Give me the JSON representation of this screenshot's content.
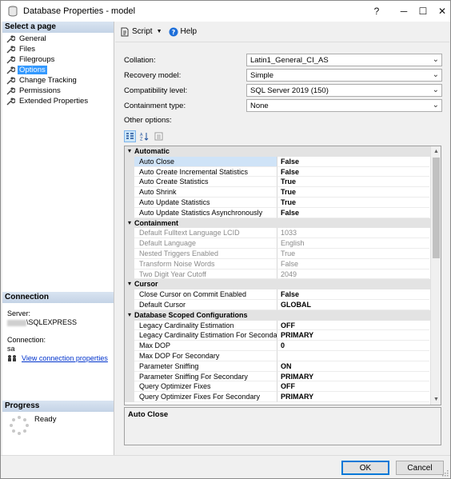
{
  "window": {
    "title": "Database Properties - model",
    "help_glyph": "?",
    "min_glyph": "─",
    "max_glyph": "☐",
    "close_glyph": "✕"
  },
  "left": {
    "header": "Select a page",
    "pages": [
      {
        "label": "General"
      },
      {
        "label": "Files"
      },
      {
        "label": "Filegroups"
      },
      {
        "label": "Options",
        "selected": true
      },
      {
        "label": "Change Tracking"
      },
      {
        "label": "Permissions"
      },
      {
        "label": "Extended Properties"
      }
    ],
    "connection_header": "Connection",
    "server_label": "Server:",
    "server_value": "\\SQLEXPRESS",
    "connection_label": "Connection:",
    "connection_value": "sa",
    "view_link": "View connection properties",
    "progress_header": "Progress",
    "progress_status": "Ready"
  },
  "toolbar": {
    "script_label": "Script",
    "help_label": "Help"
  },
  "fields": {
    "collation_label": "Collation:",
    "collation_value": "Latin1_General_CI_AS",
    "recovery_label": "Recovery model:",
    "recovery_value": "Simple",
    "compat_label": "Compatibility level:",
    "compat_value": "SQL Server 2019 (150)",
    "containment_label": "Containment type:",
    "containment_value": "None",
    "other_label": "Other options:"
  },
  "grid": {
    "rows": [
      {
        "type": "cat",
        "name": "Automatic"
      },
      {
        "type": "prop",
        "name": "Auto Close",
        "value": "False",
        "selected": true
      },
      {
        "type": "prop",
        "name": "Auto Create Incremental Statistics",
        "value": "False"
      },
      {
        "type": "prop",
        "name": "Auto Create Statistics",
        "value": "True"
      },
      {
        "type": "prop",
        "name": "Auto Shrink",
        "value": "True"
      },
      {
        "type": "prop",
        "name": "Auto Update Statistics",
        "value": "True"
      },
      {
        "type": "prop",
        "name": "Auto Update Statistics Asynchronously",
        "value": "False"
      },
      {
        "type": "cat",
        "name": "Containment"
      },
      {
        "type": "prop",
        "name": "Default Fulltext Language LCID",
        "value": "1033",
        "readonly": true
      },
      {
        "type": "prop",
        "name": "Default Language",
        "value": "English",
        "readonly": true
      },
      {
        "type": "prop",
        "name": "Nested Triggers Enabled",
        "value": "True",
        "readonly": true
      },
      {
        "type": "prop",
        "name": "Transform Noise Words",
        "value": "False",
        "readonly": true
      },
      {
        "type": "prop",
        "name": "Two Digit Year Cutoff",
        "value": "2049",
        "readonly": true
      },
      {
        "type": "cat",
        "name": "Cursor"
      },
      {
        "type": "prop",
        "name": "Close Cursor on Commit Enabled",
        "value": "False"
      },
      {
        "type": "prop",
        "name": "Default Cursor",
        "value": "GLOBAL"
      },
      {
        "type": "cat",
        "name": "Database Scoped Configurations"
      },
      {
        "type": "prop",
        "name": "Legacy Cardinality Estimation",
        "value": "OFF"
      },
      {
        "type": "prop",
        "name": "Legacy Cardinality Estimation For Secondary",
        "value": "PRIMARY"
      },
      {
        "type": "prop",
        "name": "Max DOP",
        "value": "0"
      },
      {
        "type": "prop",
        "name": "Max DOP For Secondary",
        "value": ""
      },
      {
        "type": "prop",
        "name": "Parameter Sniffing",
        "value": "ON"
      },
      {
        "type": "prop",
        "name": "Parameter Sniffing For Secondary",
        "value": "PRIMARY"
      },
      {
        "type": "prop",
        "name": "Query Optimizer Fixes",
        "value": "OFF"
      },
      {
        "type": "prop",
        "name": "Query Optimizer Fixes For Secondary",
        "value": "PRIMARY"
      }
    ],
    "description_title": "Auto Close"
  },
  "footer": {
    "ok_label": "OK",
    "cancel_label": "Cancel"
  }
}
